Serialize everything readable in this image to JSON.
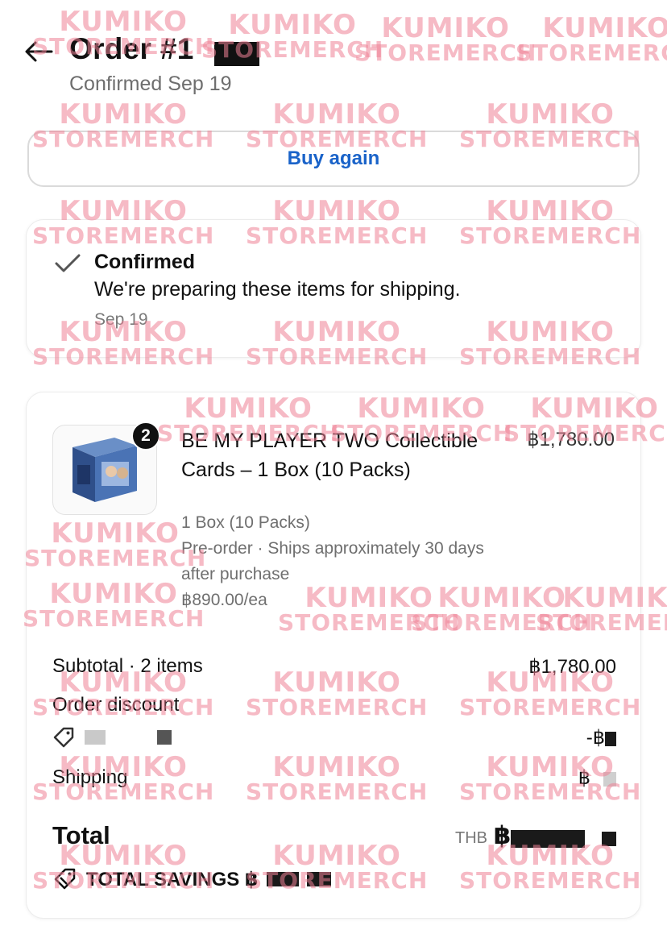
{
  "header": {
    "title": "Order #1",
    "subtitle": "Confirmed Sep 19"
  },
  "buy_again": {
    "label": "Buy again"
  },
  "status": {
    "title": "Confirmed",
    "text": "We're preparing these items for shipping.",
    "date": "Sep 19"
  },
  "item": {
    "quantity": "2",
    "title": "BE MY PLAYER TWO Collectible Cards – 1 Box (10 Packs)",
    "price": "฿1,780.00",
    "variant": "1 Box (10 Packs)",
    "preorder": "Pre-order · Ships approximately 30 days after purchase",
    "unit_price": "฿890.00/ea"
  },
  "summary": {
    "subtotal_label": "Subtotal · 2 items",
    "subtotal_value": "฿1,780.00",
    "discount_label": "Order discount",
    "discount_value_prefix": "-฿",
    "shipping_label": "Shipping",
    "shipping_value_prefix": "฿",
    "total_label": "Total",
    "total_currency": "THB",
    "total_value_prefix": "฿",
    "savings_label": "TOTAL SAVINGS ฿"
  },
  "watermark": {
    "line1": "KUMIKO",
    "line2": "STOREMERCH"
  },
  "colors": {
    "accent": "#1a63c9",
    "watermark": "#ee8296"
  },
  "icons": {
    "back": "arrow-left-icon",
    "check": "check-icon",
    "tag": "tag-icon",
    "savings": "savings-tag-icon"
  }
}
